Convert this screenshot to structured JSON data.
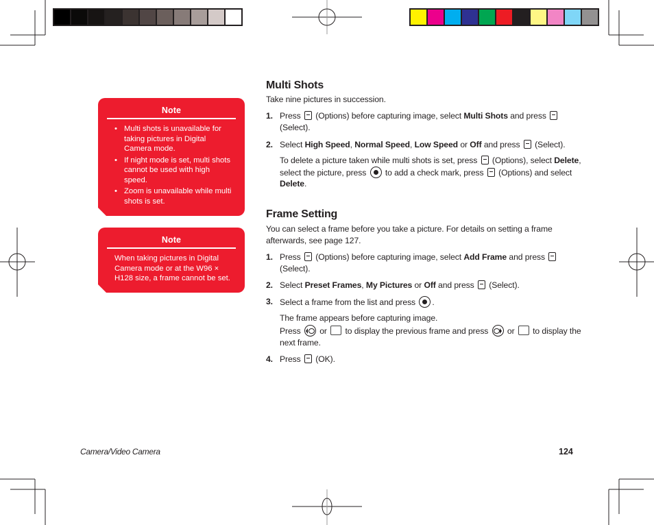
{
  "print_marks": {
    "gray_swatches": [
      "#000000",
      "#0b0a09",
      "#171413",
      "#252120",
      "#3b3331",
      "#514645",
      "#6b5f5c",
      "#877b78",
      "#a89d9a",
      "#d4cac8",
      "#ffffff"
    ],
    "color_swatches": [
      "#fff200",
      "#ec008c",
      "#00aeef",
      "#2e3192",
      "#00a651",
      "#ed1c24",
      "#231f20",
      "#fff685",
      "#f285c5",
      "#7fd6f7",
      "#939191"
    ]
  },
  "notes": [
    {
      "title": "Note",
      "items": [
        "Multi shots is unavailable for taking pictures in Digital Camera mode.",
        "If night mode is set, multi shots cannot be used with high speed.",
        "Zoom is unavailable while multi shots is set."
      ]
    },
    {
      "title": "Note",
      "text": "When taking pictures in Digital Camera mode or at the W96 × H128 size, a frame cannot be set."
    }
  ],
  "multi_shots": {
    "heading": "Multi Shots",
    "intro": "Take nine pictures in succession.",
    "steps": [
      {
        "num": "1.",
        "t1": "Press",
        "t2": "(Options) before capturing image, select",
        "b1": "Multi Shots",
        "t3": "and press",
        "t4": "(Select)."
      },
      {
        "num": "2.",
        "t1": "Select",
        "b1": "High Speed",
        "s1": ",",
        "b2": "Normal Speed",
        "s2": ",",
        "b3": "Low Speed",
        "t2": "or",
        "b4": "Off",
        "t3": "and press",
        "t4": "(Select)."
      }
    ],
    "delete_note": {
      "t1": "To delete a picture taken while multi shots is set, press",
      "t2": "(Options), select",
      "b1": "Delete",
      "t3": ", select the picture, press",
      "t4": "to add a check mark, press",
      "t5": "(Options) and select",
      "b2": "Delete",
      "t6": "."
    }
  },
  "frame_setting": {
    "heading": "Frame Setting",
    "intro": "You can select a frame before you take a picture. For details on setting a frame afterwards, see page 127.",
    "steps": [
      {
        "num": "1.",
        "t1": "Press",
        "t2": "(Options) before capturing image, select",
        "b1": "Add Frame",
        "t3": "and press",
        "t4": "(Select)."
      },
      {
        "num": "2.",
        "t1": "Select",
        "b1": "Preset Frames",
        "s1": ",",
        "b2": "My Pictures",
        "t2": "or",
        "b3": "Off",
        "t3": "and press",
        "t4": "(Select)."
      },
      {
        "num": "3.",
        "t1": "Select a frame from the list and press",
        "t2": "."
      },
      {
        "num": "4.",
        "t1": "Press",
        "t2": "(OK)."
      }
    ],
    "step3_detail": {
      "line1": "The frame appears before capturing image.",
      "t1": "Press",
      "t2": "or",
      "t3": "to display the previous frame and press",
      "t4": "or",
      "t5": "to display the next frame."
    },
    "key_labels": {
      "star": "*    ",
      "hash": "#  "
    }
  },
  "footer": {
    "section": "Camera/Video Camera",
    "page": "124"
  }
}
